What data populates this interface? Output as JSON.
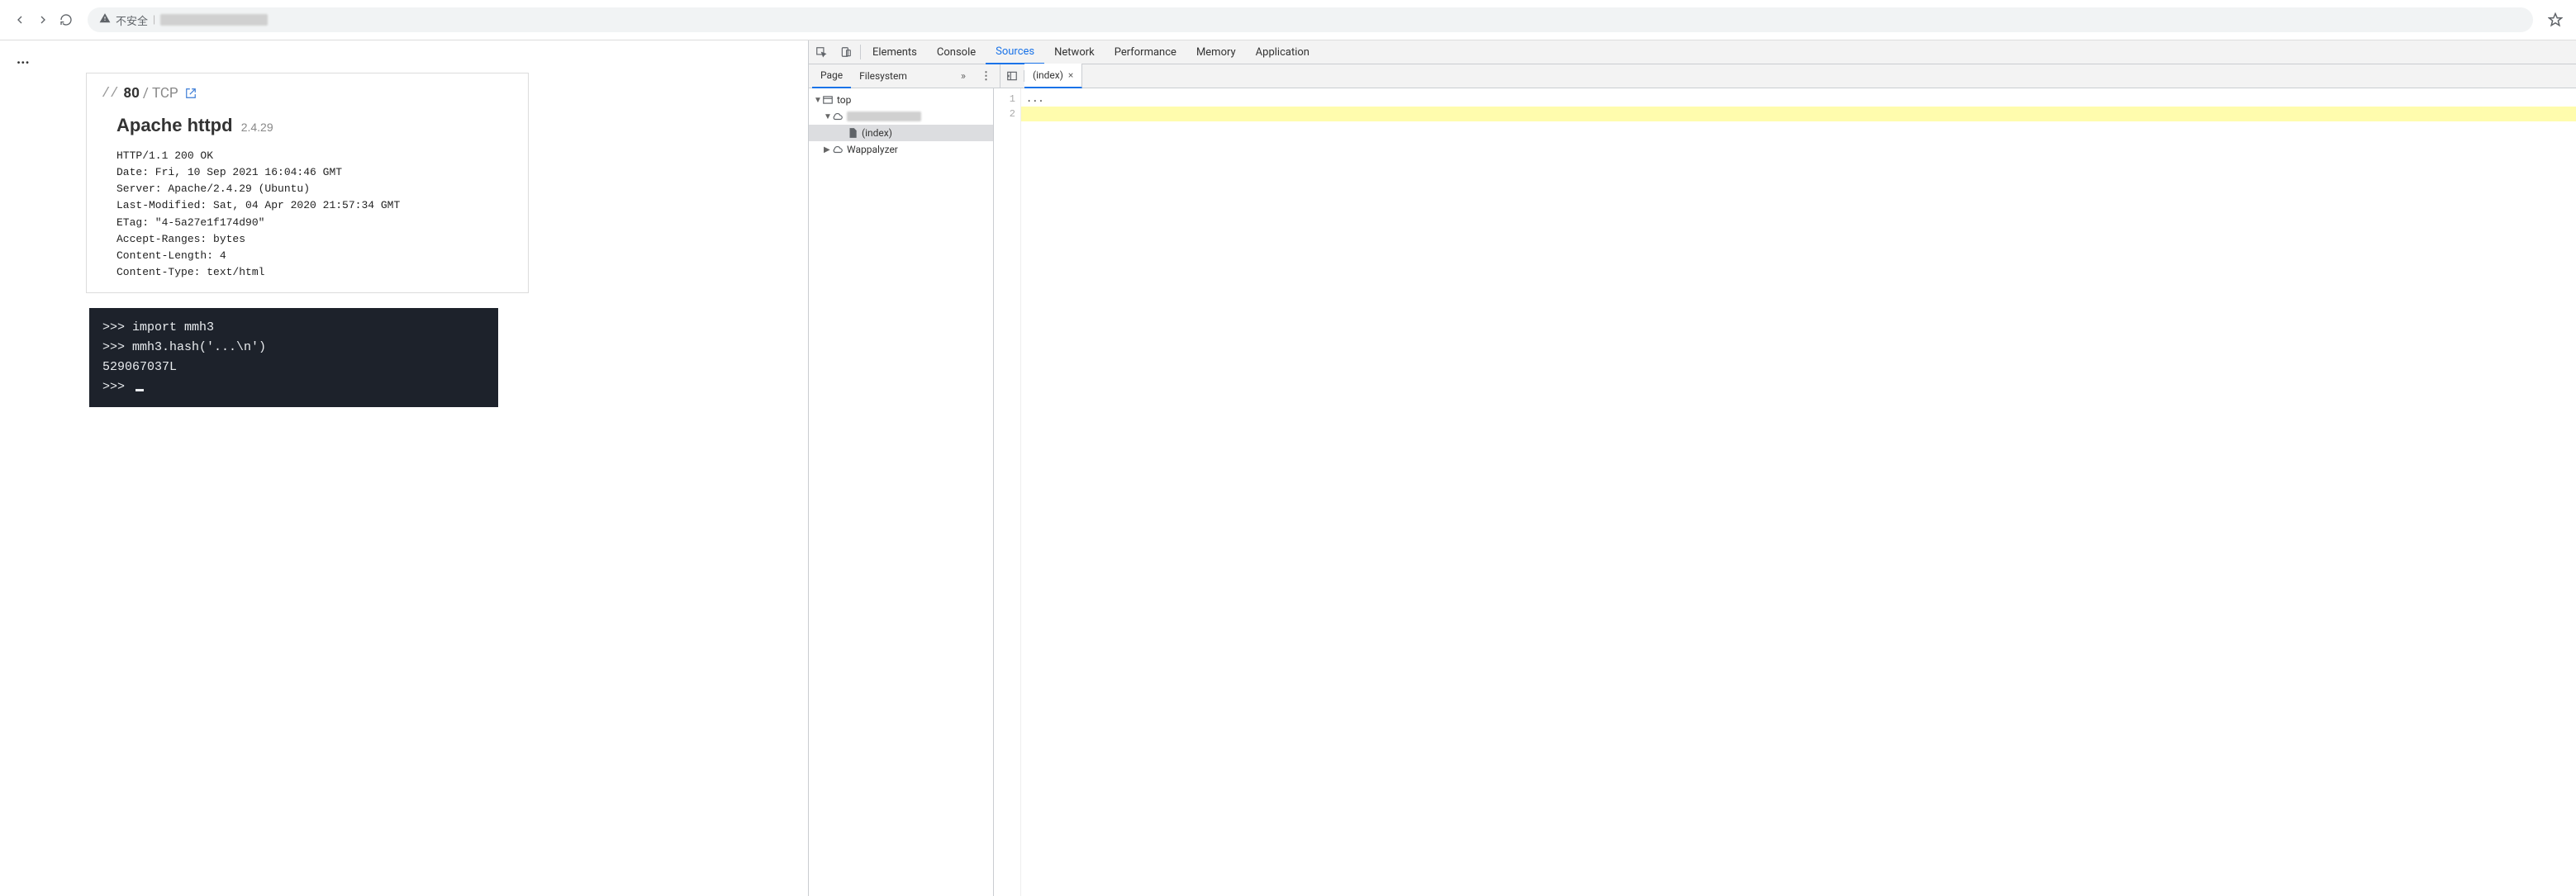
{
  "browser": {
    "insecure_warning": "不安全"
  },
  "devtools": {
    "tabs": {
      "elements": "Elements",
      "console": "Console",
      "sources": "Sources",
      "network": "Network",
      "performance": "Performance",
      "memory": "Memory",
      "application": "Application"
    },
    "subtabs": {
      "page": "Page",
      "filesystem": "Filesystem"
    },
    "file_tab": "(index)",
    "tree": {
      "top": "top",
      "index": "(index)",
      "wappalyzer": "Wappalyzer"
    },
    "code": {
      "line1_num": "1",
      "line2_num": "2",
      "line1": "..."
    }
  },
  "page": {
    "ellipsis": "...",
    "port_card": {
      "slashes": "//",
      "port": "80",
      "proto_sep": "/",
      "proto": "TCP",
      "service": "Apache httpd",
      "version": "2.4.29",
      "http": {
        "status": "HTTP/1.1 200 OK",
        "date": "Date: Fri, 10 Sep 2021 16:04:46 GMT",
        "server": "Server: Apache/2.4.29 (Ubuntu)",
        "last_modified": "Last-Modified: Sat, 04 Apr 2020 21:57:34 GMT",
        "etag": "ETag: \"4-5a27e1f174d90\"",
        "accept_ranges": "Accept-Ranges: bytes",
        "content_length": "Content-Length: 4",
        "content_type": "Content-Type: text/html"
      }
    },
    "terminal": {
      "prompt": ">>>",
      "l1": ">>> import mmh3",
      "l2": ">>> mmh3.hash('...\\n')",
      "l3": "529067037L",
      "l4": ">>> "
    }
  }
}
